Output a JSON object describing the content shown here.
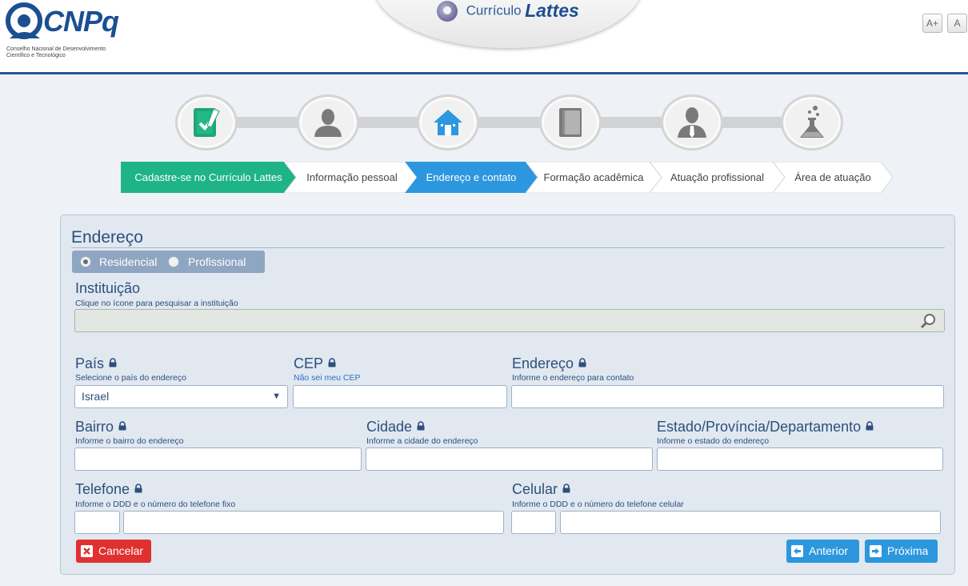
{
  "header": {
    "logo_text": "CNPq",
    "logo_subtitle_1": "Conselho Nacional de Desenvolvimento",
    "logo_subtitle_2": "Científico e Tecnológico",
    "title_prefix": "Currículo",
    "title_main": "Lattes",
    "font_increase_label": "A+",
    "font_reset_label": "A"
  },
  "steps": [
    {
      "label": "Cadastre-se no Currículo Lattes",
      "state": "done",
      "icon": "checklist-icon"
    },
    {
      "label": "Informação pessoal",
      "state": "pending",
      "icon": "person-icon"
    },
    {
      "label": "Endereço e contato",
      "state": "current",
      "icon": "home-icon"
    },
    {
      "label": "Formação acadêmica",
      "state": "pending",
      "icon": "book-icon"
    },
    {
      "label": "Atuação profissional",
      "state": "pending",
      "icon": "professional-icon"
    },
    {
      "label": "Área de atuação",
      "state": "pending",
      "icon": "flask-icon"
    }
  ],
  "colors": {
    "done": "#1fb487",
    "current": "#2c97de",
    "pending": "#ffffff",
    "accent_blue": "#24589a",
    "cancel": "#e03131",
    "nav_button": "#2c97de"
  },
  "form": {
    "section_title": "Endereço",
    "address_type": {
      "options": [
        "Residencial",
        "Profissional"
      ],
      "selected": "Residencial"
    },
    "instituicao": {
      "label": "Instituição",
      "hint": "Clique no ícone para pesquisar a instituição",
      "value": ""
    },
    "pais": {
      "label": "País",
      "hint": "Selecione o país do endereço",
      "value": "Israel"
    },
    "cep": {
      "label": "CEP",
      "hint": "Não sei meu CEP",
      "value": ""
    },
    "endereco": {
      "label": "Endereço",
      "hint": "Informe o endereço para contato",
      "value": ""
    },
    "bairro": {
      "label": "Bairro",
      "hint": "Informe o bairro do endereço",
      "value": ""
    },
    "cidade": {
      "label": "Cidade",
      "hint": "Informe a cidade do endereço",
      "value": ""
    },
    "estado": {
      "label": "Estado/Província/Departamento",
      "hint": "Informe o estado do endereço",
      "value": ""
    },
    "telefone": {
      "label": "Telefone",
      "hint": "Informe o DDD e o número do telefone fixo",
      "ddd": "",
      "numero": ""
    },
    "celular": {
      "label": "Celular",
      "hint": "Informe o DDD e o número do telefone celular",
      "ddd": "",
      "numero": ""
    }
  },
  "buttons": {
    "cancel": "Cancelar",
    "previous": "Anterior",
    "next": "Próxima"
  }
}
